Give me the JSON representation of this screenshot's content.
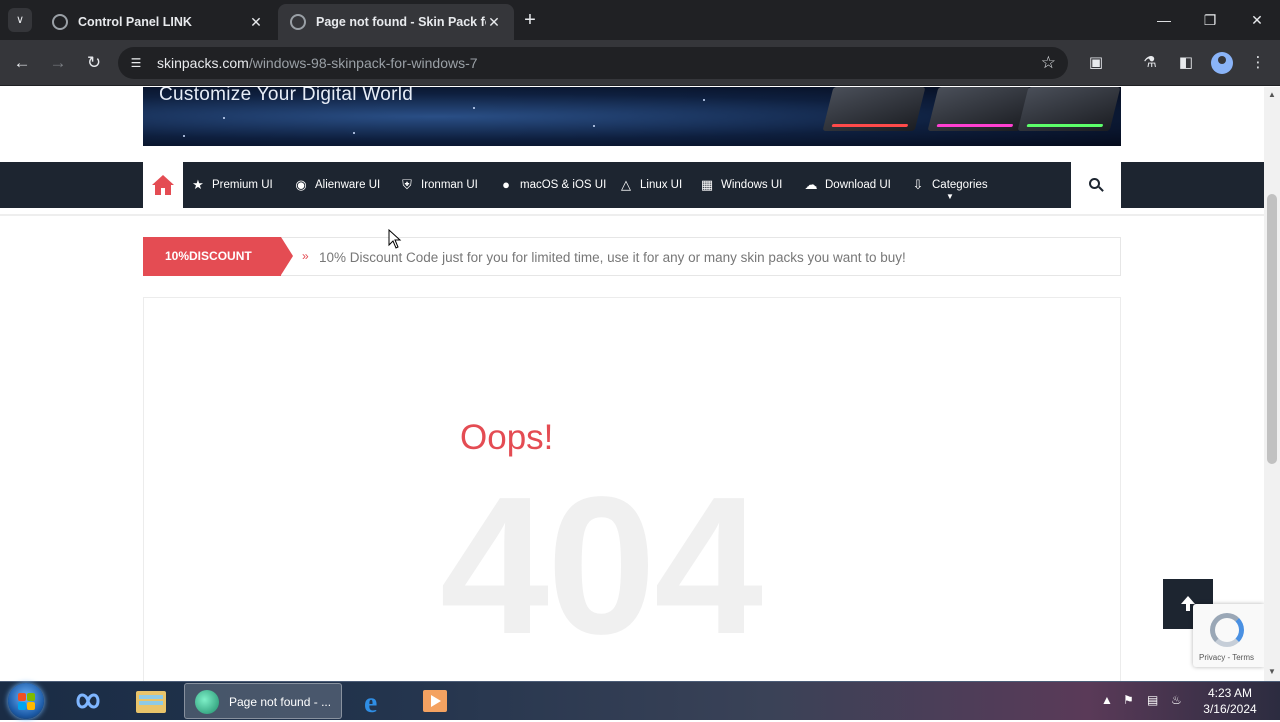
{
  "browser": {
    "tabs": [
      {
        "title": "Control Panel LINK",
        "active": false
      },
      {
        "title": "Page not found - Skin Pack for",
        "active": true
      }
    ],
    "url_domain": "skinpacks.com",
    "url_path": "/windows-98-skinpack-for-windows-7"
  },
  "site": {
    "banner_tagline": "Customize Your Digital World",
    "nav": {
      "items": [
        {
          "label": "Premium UI",
          "icon": "star-icon"
        },
        {
          "label": "Alienware UI",
          "icon": "alien-icon"
        },
        {
          "label": "Ironman UI",
          "icon": "transformer-icon"
        },
        {
          "label": "macOS & iOS UI",
          "icon": "apple-icon"
        },
        {
          "label": "Linux UI",
          "icon": "linux-icon"
        },
        {
          "label": "Windows UI",
          "icon": "windows-icon"
        },
        {
          "label": "Download UI",
          "icon": "cloud-download-icon"
        },
        {
          "label": "Categories",
          "icon": "download-icon"
        }
      ]
    },
    "ticker": {
      "badge": "10%DISCOUNT",
      "message": "10% Discount Code just for you for limited time, use it for any or many skin packs you want to buy!"
    },
    "error": {
      "heading": "Oops!",
      "code": "404"
    },
    "recaptcha": {
      "privacy": "Privacy",
      "separator": " - ",
      "terms": "Terms"
    },
    "colors": {
      "accent": "#e44c53",
      "navbar": "#1d2530"
    }
  },
  "taskbar": {
    "active_task_label": "Page not found - ...",
    "time": "4:23 AM",
    "date": "3/16/2024"
  }
}
